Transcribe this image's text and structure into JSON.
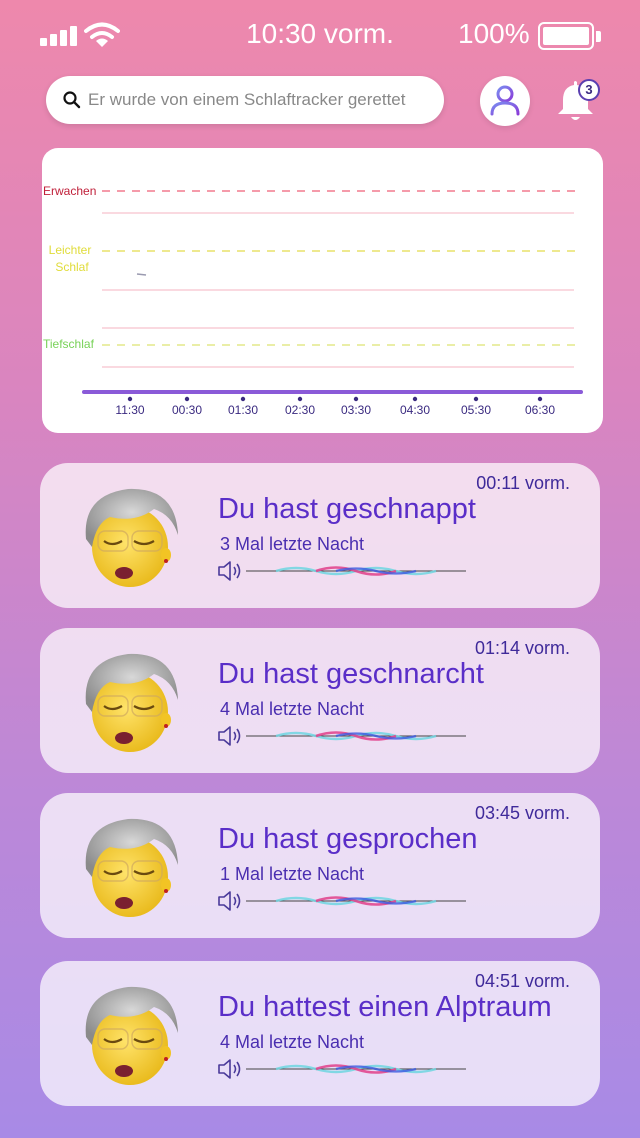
{
  "status_bar": {
    "time": "10:30 vorm.",
    "battery": "100%"
  },
  "header": {
    "search_placeholder": "Er wurde von einem Schlaftracker gerettet",
    "notification_count": "3"
  },
  "sleep_chart": {
    "stage_labels": {
      "awake": "Erwachen",
      "light_line1": "Leichter",
      "light_line2": "Schlaf",
      "deep": "Tiefschlaf"
    },
    "time_ticks": [
      "11:30",
      "00:30",
      "01:30",
      "02:30",
      "03:30",
      "04:30",
      "05:30",
      "06:30"
    ]
  },
  "events": [
    {
      "time": "00:11 vorm.",
      "title": "Du hast geschnappt",
      "subtitle": "3 Mal letzte Nacht"
    },
    {
      "time": "01:14 vorm.",
      "title": "Du hast geschnarcht",
      "subtitle": "4 Mal letzte Nacht"
    },
    {
      "time": "03:45 vorm.",
      "title": "Du hast gesprochen",
      "subtitle": "1 Mal letzte Nacht"
    },
    {
      "time": "04:51 vorm.",
      "title": "Du hattest einen Alptraum",
      "subtitle": "4 Mal letzte Nacht"
    }
  ],
  "colors": {
    "accent": "#5a2ec8",
    "awake_line": "#f27a8e",
    "light_line": "#e8e26a",
    "deep_line": "#a8e28a",
    "timeline": "#8a5ad8"
  },
  "icons": {
    "signal": "cellular-signal-icon",
    "wifi": "wifi-icon",
    "battery": "battery-icon",
    "search": "search-icon",
    "avatar": "user-avatar-icon",
    "bell": "bell-icon",
    "speaker": "speaker-icon",
    "face": "sleeping-face-memoji"
  }
}
